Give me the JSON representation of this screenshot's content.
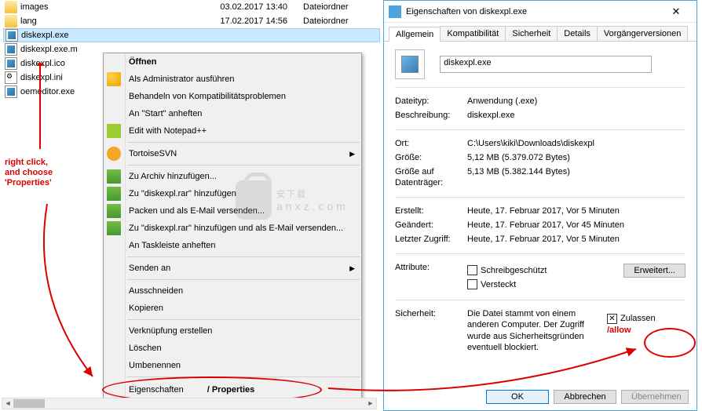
{
  "filelist": [
    {
      "name": "images",
      "date": "03.02.2017 13:40",
      "type": "Dateiordner",
      "icon": "folder"
    },
    {
      "name": "lang",
      "date": "17.02.2017 14:56",
      "type": "Dateiordner",
      "icon": "folder"
    },
    {
      "name": "diskexpl.exe",
      "date": "",
      "type": "",
      "icon": "exe",
      "sel": true
    },
    {
      "name": "diskexpl.exe.m",
      "date": "",
      "type": "",
      "icon": "exe"
    },
    {
      "name": "diskexpl.ico",
      "date": "",
      "type": "",
      "icon": "exe"
    },
    {
      "name": "diskexpl.ini",
      "date": "",
      "type": "",
      "icon": "ini"
    },
    {
      "name": "oemeditor.exe",
      "date": "",
      "type": "",
      "icon": "exe"
    }
  ],
  "annotation": {
    "text1": "right click,",
    "text2": "and choose",
    "text3": "'Properties'"
  },
  "ctx": {
    "open": "Öffnen",
    "admin": "Als Administrator ausführen",
    "compat": "Behandeln von Kompatibilitätsproblemen",
    "start": "An \"Start\" anheften",
    "npp": "Edit with Notepad++",
    "svn": "TortoiseSVN",
    "zip1": "Zu Archiv hinzufügen...",
    "zip2": "Zu \"diskexpl.rar\" hinzufügen",
    "zip3": "Packen und als E-Mail versenden...",
    "zip4": "Zu \"diskexpl.rar\" hinzufügen und als E-Mail versenden...",
    "taskbar": "An Taskleiste anheften",
    "sendto": "Senden an",
    "cut": "Ausschneiden",
    "copy": "Kopieren",
    "link": "Verknüpfung erstellen",
    "del": "Löschen",
    "ren": "Umbenennen",
    "prop": "Eigenschaften",
    "prop_en": "/ Properties"
  },
  "dlg": {
    "title": "Eigenschaften von diskexpl.exe",
    "tabs": [
      "Allgemein",
      "Kompatibilität",
      "Sicherheit",
      "Details",
      "Vorgängerversionen"
    ],
    "filename": "diskexpl.exe",
    "rows": {
      "dateityp_k": "Dateityp:",
      "dateityp_v": "Anwendung (.exe)",
      "beschr_k": "Beschreibung:",
      "beschr_v": "diskexpl.exe",
      "ort_k": "Ort:",
      "ort_v": "C:\\Users\\kiki\\Downloads\\diskexpl",
      "groesse_k": "Größe:",
      "groesse_v": "5,12 MB (5.379.072 Bytes)",
      "disk_k": "Größe auf Datenträger:",
      "disk_v": "5,13 MB (5.382.144 Bytes)",
      "erst_k": "Erstellt:",
      "erst_v": "Heute, 17. Februar 2017, Vor 5 Minuten",
      "geae_k": "Geändert:",
      "geae_v": "Heute, 17. Februar 2017, Vor 45 Minuten",
      "zugr_k": "Letzter Zugriff:",
      "zugr_v": "Heute, 17. Februar 2017, Vor 5 Minuten",
      "attr_k": "Attribute:",
      "ro": "Schreibgeschützt",
      "hidden": "Versteckt",
      "erw": "Erweitert...",
      "sich_k": "Sicherheit:",
      "sich_v": "Die Datei stammt von einem anderen Computer. Der Zugriff wurde aus Sicherheitsgründen eventuell blockiert.",
      "zulassen": "Zulassen",
      "allow": "/allow"
    },
    "btns": {
      "ok": "OK",
      "cancel": "Abbrechen",
      "apply": "Übernehmen"
    }
  },
  "watermark": {
    "big": "安下载",
    "small": "anxz.com"
  }
}
